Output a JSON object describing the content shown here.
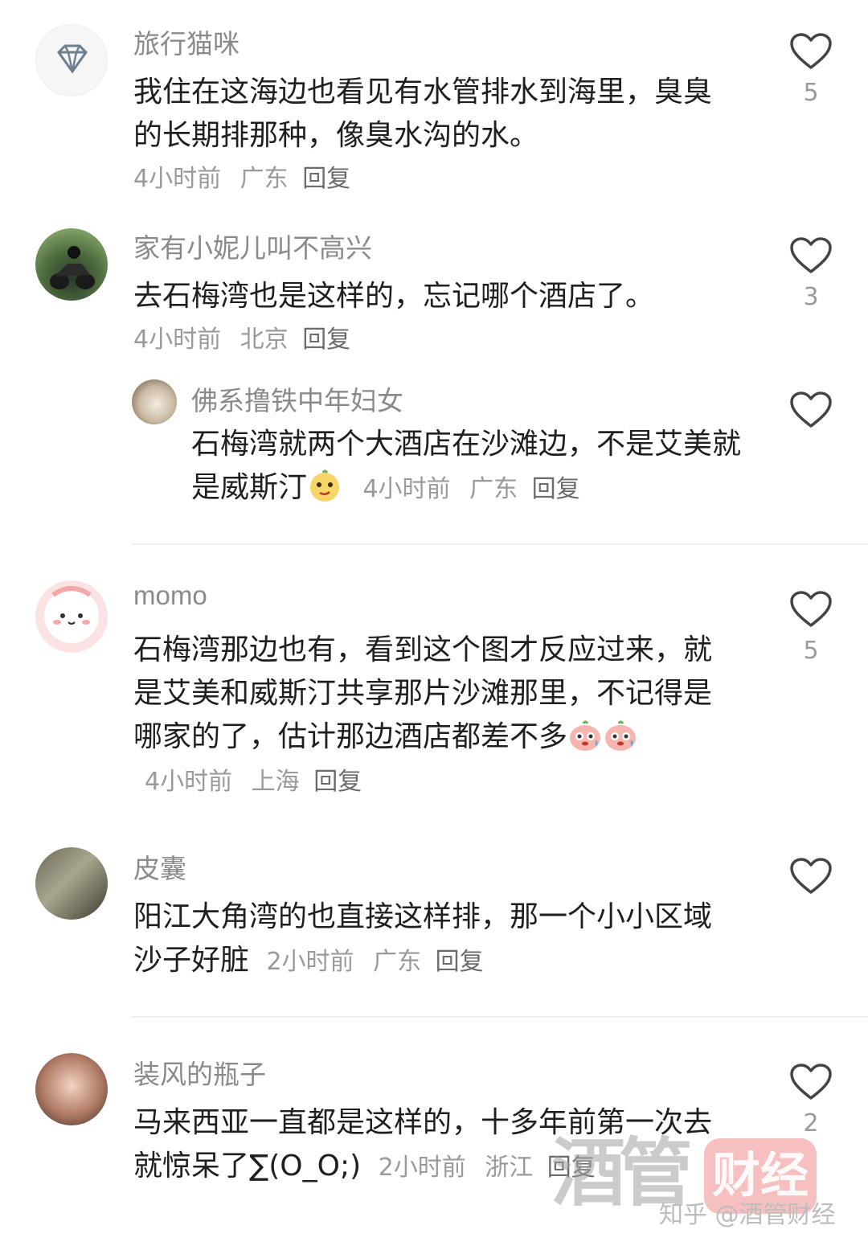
{
  "comments": [
    {
      "author": "旅行猫咪",
      "text": "我住在这海边也看见有水管排水到海里，臭臭的长期排那种，像臭水沟的水。",
      "time": "4小时前",
      "location": "广东",
      "reply_label": "回复",
      "likes": "5",
      "avatar_icon": "diamond-icon"
    },
    {
      "author": "家有小妮儿叫不高兴",
      "text": "去石梅湾也是这样的，忘记哪个酒店了。",
      "time": "4小时前",
      "location": "北京",
      "reply_label": "回复",
      "likes": "3"
    },
    {
      "author": "佛系撸铁中年妇女",
      "text": "石梅湾就两个大酒店在沙滩边，不是艾美就是威斯汀",
      "time": "4小时前",
      "location": "广东",
      "reply_label": "回复",
      "likes": "",
      "emoji": "smirk-emoji-icon"
    },
    {
      "author": "momo",
      "text": "石梅湾那边也有，看到这个图才反应过来，就是艾美和威斯汀共享那片沙滩那里，不记得是哪家的了，估计那边酒店都差不多",
      "time": "4小时前",
      "location": "上海",
      "reply_label": "回复",
      "likes": "5",
      "emoji": "sweat-emoji-icon"
    },
    {
      "author": "皮囊",
      "text": "阳江大角湾的也直接这样排，那一个小小区域沙子好脏",
      "time": "2小时前",
      "location": "广东",
      "reply_label": "回复",
      "likes": ""
    },
    {
      "author": "装风的瓶子",
      "text": "马来西亚一直都是这样的，十多年前第一次去就惊呆了∑(O_O;)",
      "time": "2小时前",
      "location": "浙江",
      "reply_label": "回复",
      "likes": "2"
    }
  ],
  "watermark": {
    "logo_part1": "酒管",
    "logo_part2": "财经",
    "credit": "知乎 @酒管财经"
  },
  "colors": {
    "text": "#1f1f1f",
    "meta": "#9a9a9a",
    "author": "#8a8a8a",
    "divider": "#eeeeee"
  }
}
